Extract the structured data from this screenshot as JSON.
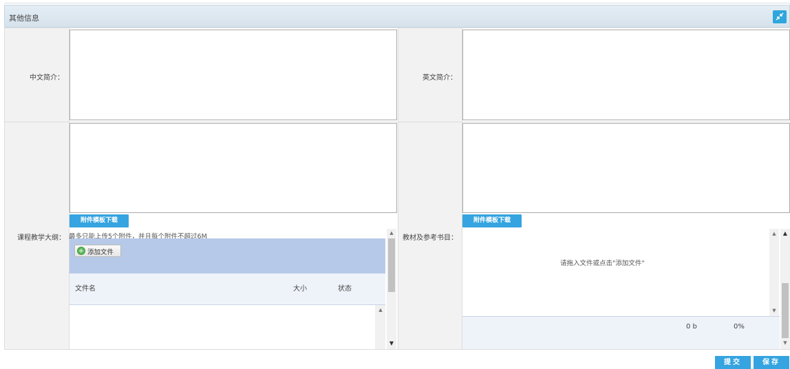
{
  "panel": {
    "title": "其他信息",
    "collapse_icon": "collapse-arrows-icon"
  },
  "fields": {
    "cn_intro_label": "中文简介：",
    "en_intro_label": "英文简介：",
    "syllabus_label": "课程教学大纲：",
    "textbook_label": "教材及参考书目："
  },
  "syllabus": {
    "template_btn": "附件模板下载",
    "upload_note": "最多只能上传5个附件，并且每个附件不超过6M",
    "add_file_btn": "添加文件",
    "columns": {
      "name": "文件名",
      "size": "大小",
      "status": "状态"
    }
  },
  "textbook": {
    "template_btn": "附件模板下载",
    "drop_hint": "请拖入文件或点击\"添加文件\"",
    "total_size": "0 b",
    "progress": "0%"
  },
  "actions": {
    "submit": "提交",
    "save": "保存"
  },
  "colors": {
    "accent": "#35a4e0",
    "upload_bg": "#b6c9e8",
    "label_bg": "#f2f2f2"
  }
}
